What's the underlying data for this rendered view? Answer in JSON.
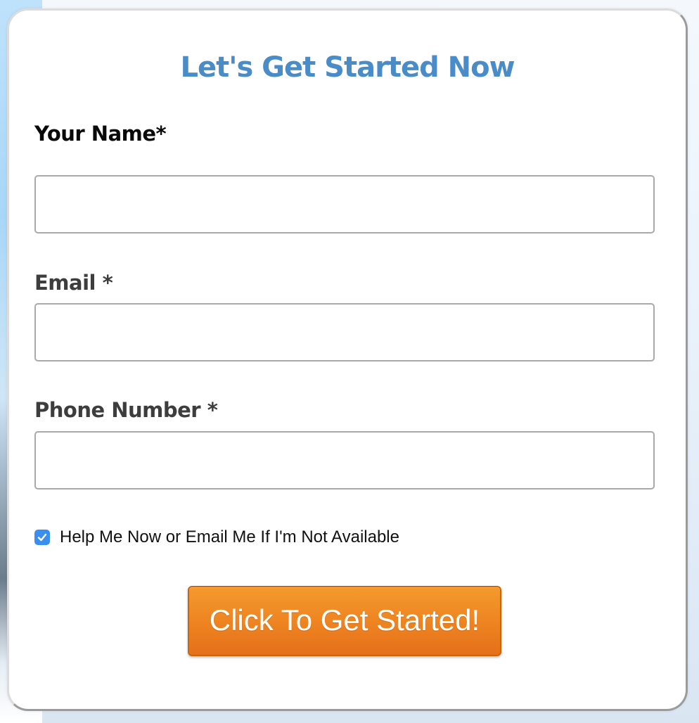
{
  "form": {
    "title": "Let's Get Started Now",
    "name_label": "Your Name*",
    "name_value": "",
    "email_label": "Email *",
    "email_value": "",
    "phone_label": "Phone Number *",
    "phone_value": "",
    "consent_label": "Help Me Now or Email Me If I'm Not Available",
    "consent_checked": true,
    "submit_label": "Click To Get Started!"
  },
  "colors": {
    "title": "#4a8cc8",
    "checkbox": "#3a8ef0",
    "button_top": "#f39a2e",
    "button_bottom": "#e5701a"
  },
  "icons": {
    "checkbox_mark": "check-icon"
  }
}
